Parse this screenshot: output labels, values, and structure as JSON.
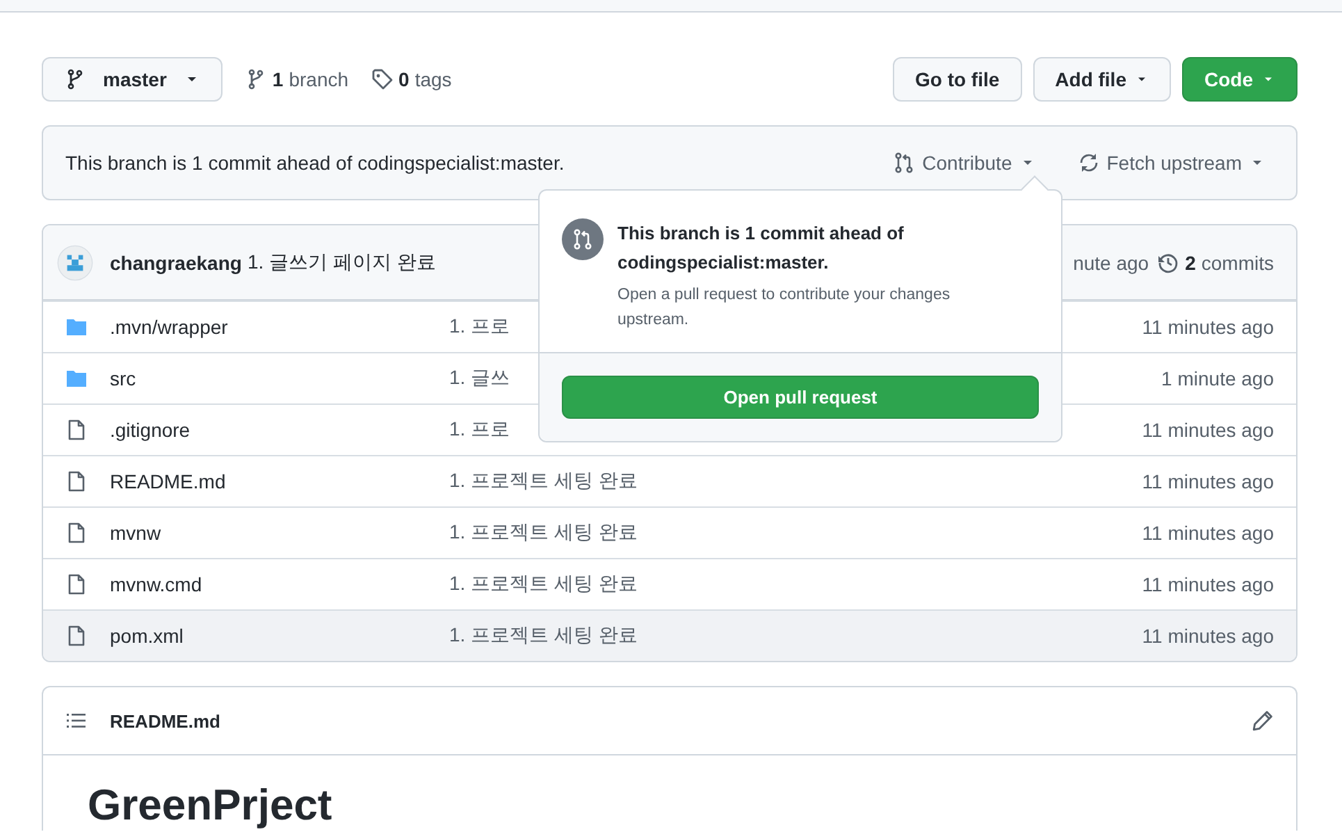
{
  "toolbar": {
    "branch_button": "master",
    "branch_count": "1",
    "branch_label": "branch",
    "tag_count": "0",
    "tag_label": "tags",
    "buttons": [
      {
        "label": "Go to file",
        "kind": "plain"
      },
      {
        "label": "Add file",
        "kind": "dropdown"
      },
      {
        "label": "Code",
        "kind": "primary"
      }
    ]
  },
  "banner": {
    "text": "This branch is 1 commit ahead of codingspecialist:master.",
    "actions": [
      {
        "label": "Contribute",
        "kind": "contribute"
      },
      {
        "label": "Fetch upstream",
        "kind": "fetch"
      }
    ]
  },
  "popover": {
    "title": "This branch is 1 commit ahead of codingspecialist:master.",
    "description": "Open a pull request to contribute your changes upstream.",
    "button": "Open pull request"
  },
  "latest_commit": {
    "author": "changraekang",
    "message": "1. 글쓰기 페이지 완료",
    "time": "nute ago",
    "commits_count": "2",
    "commits_label": "commits"
  },
  "files": [
    {
      "name": ".mvn/wrapper",
      "kind": "folder",
      "message": "1. 프로",
      "time": "11 minutes ago",
      "hovered": false
    },
    {
      "name": "src",
      "kind": "folder",
      "message": "1. 글쓰",
      "time": "1 minute ago",
      "hovered": false
    },
    {
      "name": ".gitignore",
      "kind": "file",
      "message": "1. 프로",
      "time": "11 minutes ago",
      "hovered": false
    },
    {
      "name": "README.md",
      "kind": "file",
      "message": "1. 프로젝트 세팅 완료",
      "time": "11 minutes ago",
      "hovered": false
    },
    {
      "name": "mvnw",
      "kind": "file",
      "message": "1. 프로젝트 세팅 완료",
      "time": "11 minutes ago",
      "hovered": false
    },
    {
      "name": "mvnw.cmd",
      "kind": "file",
      "message": "1. 프로젝트 세팅 완료",
      "time": "11 minutes ago",
      "hovered": false
    },
    {
      "name": "pom.xml",
      "kind": "file",
      "message": "1. 프로젝트 세팅 완료",
      "time": "11 minutes ago",
      "hovered": true
    }
  ],
  "readme": {
    "filename": "README.md",
    "heading": "GreenPrject"
  }
}
